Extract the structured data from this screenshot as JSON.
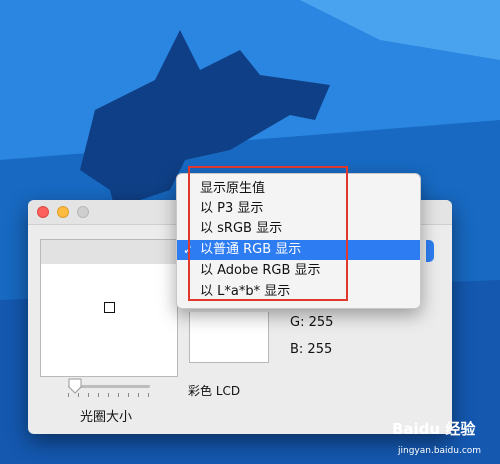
{
  "menu": {
    "items": [
      {
        "label": "显示原生值",
        "selected": false
      },
      {
        "label": "以 P3 显示",
        "selected": false
      },
      {
        "label": "以 sRGB 显示",
        "selected": false
      },
      {
        "label": "以普通 RGB 显示",
        "selected": true
      },
      {
        "label": "以 Adobe RGB 显示",
        "selected": false
      },
      {
        "label": "以 L*a*b* 显示",
        "selected": false
      }
    ],
    "check_glyph": "✓"
  },
  "readout": {
    "g": "G: 255",
    "b": "B: 255"
  },
  "profile_label": "彩色 LCD",
  "slider": {
    "label": "光圈大小",
    "value": 0.08
  },
  "watermark": {
    "logo": "Baidu 经验",
    "url": "jingyan.baidu.com"
  },
  "colors": {
    "accent": "#2d7cf2",
    "highlight_box": "#e0382c",
    "desktop": "#1769c2"
  },
  "icons": [
    "close-light",
    "minimize-light",
    "zoom-light",
    "checkmark-icon",
    "slider-thumb-icon",
    "popup-arrows-icon"
  ]
}
